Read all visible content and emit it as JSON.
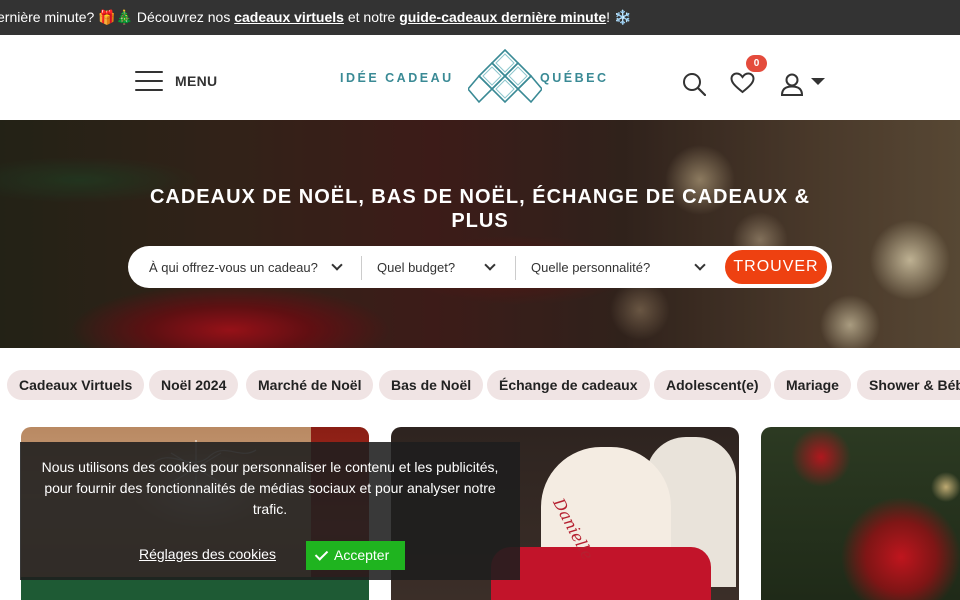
{
  "announcement": {
    "prefix": "ernière minute? ",
    "emoji1": "🎁🎄",
    "mid1": " Découvrez nos ",
    "link1": "cadeaux virtuels",
    "mid2": " et notre ",
    "link2": "guide-cadeaux dernière minute",
    "suffix": "! ❄️"
  },
  "header": {
    "menu_label": "MENU",
    "logo_left": "IDÉE CADEAU",
    "logo_right": "QUÉBEC",
    "wishlist_count": "0"
  },
  "hero": {
    "title": "Cadeaux de Noël, bas de Noël, échange de cadeaux & plus",
    "filters": [
      {
        "label": "À qui offrez-vous un cadeau?"
      },
      {
        "label": "Quel budget?"
      },
      {
        "label": "Quelle personnalité?"
      }
    ],
    "find_button": "TROUVER"
  },
  "categories": [
    {
      "label": "Cadeaux Virtuels"
    },
    {
      "label": "Noël 2024"
    },
    {
      "label": "Marché de Noël"
    },
    {
      "label": "Bas de Noël"
    },
    {
      "label": "Échange de cadeaux"
    },
    {
      "label": "Adolescent(e)"
    },
    {
      "label": "Mariage"
    },
    {
      "label": "Shower & Bébé"
    }
  ],
  "cards": [
    {
      "image": "gift-wrapped-package"
    },
    {
      "image": "christmas-stocking",
      "stocking_name": "Danielle"
    },
    {
      "image": "christmas-ornaments"
    }
  ],
  "cookie": {
    "text": "Nous utilisons des cookies pour personnaliser le contenu et les publicités, pour fournir des fonctionnalités de médias sociaux et pour analyser notre trafic.",
    "settings_label": "Réglages des cookies",
    "accept_label": "Accepter"
  },
  "colors": {
    "accent": "#ee4111",
    "brand": "#3a8a95",
    "badge": "#e44b3c",
    "cookie_accept": "#1fb41f"
  }
}
